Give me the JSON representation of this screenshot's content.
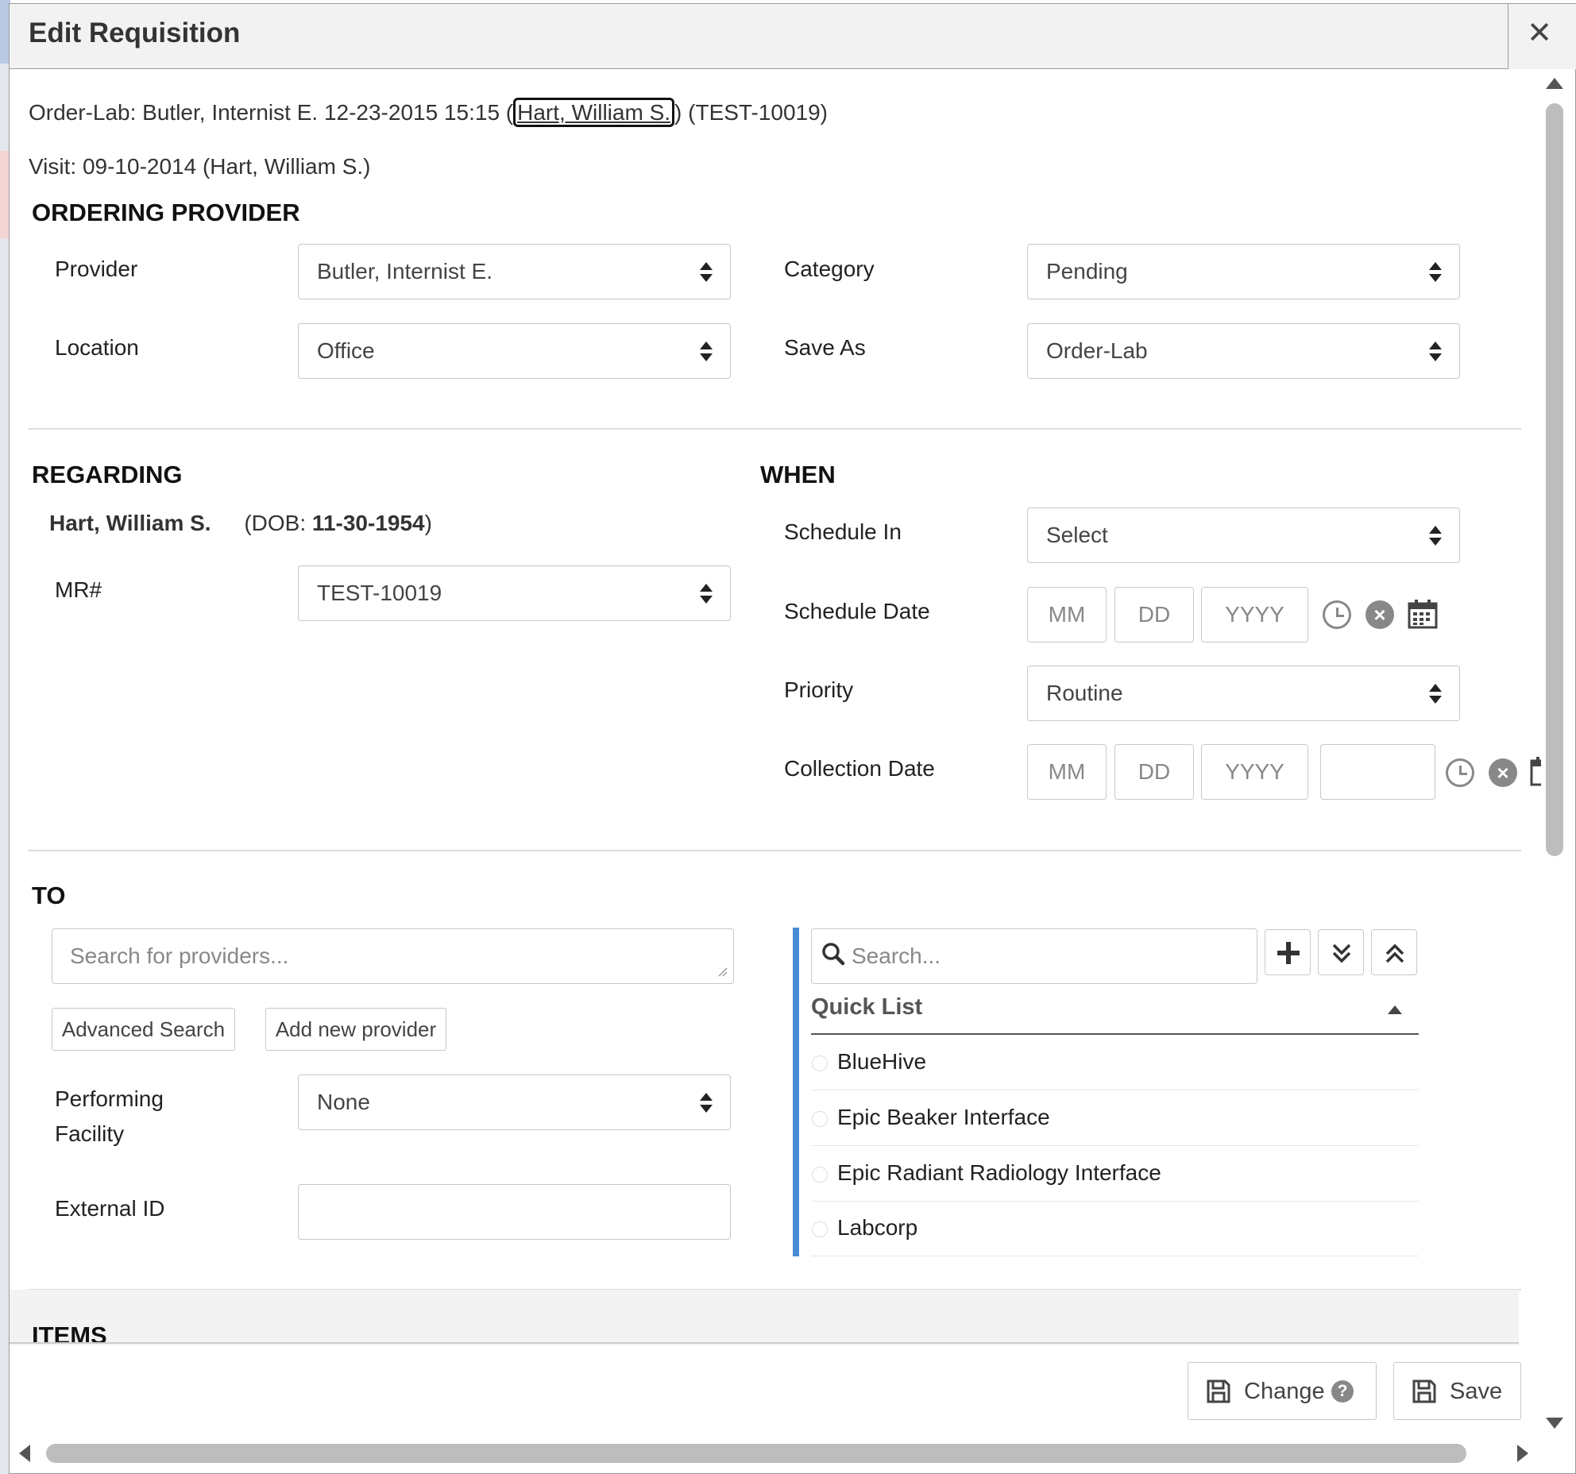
{
  "dialog": {
    "title": "Edit Requisition",
    "header_line": {
      "prefix": "Order-Lab: Butler, Internist E. 12-23-2015 15:15 (",
      "patient_link": "Hart, William S.",
      "suffix": ") (TEST-10019)"
    },
    "visit_line": "Visit: 09-10-2014 (Hart, William S.)"
  },
  "ordering_provider": {
    "heading": "ORDERING PROVIDER",
    "provider_label": "Provider",
    "provider_value": "Butler, Internist E.",
    "location_label": "Location",
    "location_value": "Office",
    "category_label": "Category",
    "category_value": "Pending",
    "save_as_label": "Save As",
    "save_as_value": "Order-Lab"
  },
  "regarding": {
    "heading": "REGARDING",
    "patient_name": "Hart, William S.",
    "dob_prefix": "(DOB: ",
    "dob": "11-30-1954",
    "dob_suffix": ")",
    "mr_label": "MR#",
    "mr_value": "TEST-10019"
  },
  "when": {
    "heading": "WHEN",
    "schedule_in_label": "Schedule In",
    "schedule_in_value": "Select",
    "schedule_date_label": "Schedule Date",
    "priority_label": "Priority",
    "priority_value": "Routine",
    "collection_date_label": "Collection Date",
    "date_placeholders": {
      "mm": "MM",
      "dd": "DD",
      "yyyy": "YYYY"
    }
  },
  "to": {
    "heading": "TO",
    "search_placeholder": "Search for providers...",
    "advanced_search": "Advanced Search",
    "add_new_provider": "Add new provider",
    "performing_facility_label_1": "Performing",
    "performing_facility_label_2": "Facility",
    "performing_facility_value": "None",
    "external_id_label": "External ID",
    "external_id_value": ""
  },
  "quick_list": {
    "search_placeholder": "Search...",
    "title": "Quick List",
    "items": [
      "BlueHive",
      "Epic Beaker Interface",
      "Epic Radiant Radiology Interface",
      "Labcorp"
    ]
  },
  "items_section": {
    "heading": "ITEMS"
  },
  "footer": {
    "change_label": "Change",
    "save_label": "Save"
  },
  "colors": {
    "accent": "#4a8bd6",
    "border": "#c8c8c8",
    "text": "#333333"
  }
}
